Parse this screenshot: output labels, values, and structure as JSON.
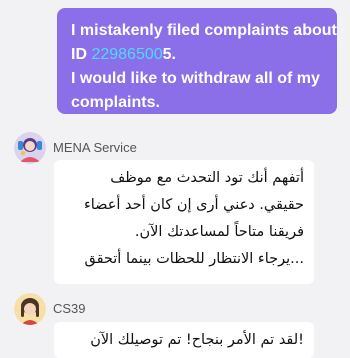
{
  "user_message": {
    "line1": "I mistakenly filed complaints about",
    "line2_prefix": "ID ",
    "ticket_id": "22986500",
    "line2_suffix": "5.",
    "line3": "I would like to withdraw all of my",
    "line4": "complaints."
  },
  "agent_message_1": {
    "sender": "MENA Service",
    "avatar_icon": "service-agent-avatar",
    "lines": [
      "أتفهم أنك تود التحدث مع موظف",
      "حقيقي. دعني أرى إن كان أحد أعضاء",
      "فريقنا متاحاً لمساعدتك الآن.",
      "...يرجاء الانتظار للحظات بينما أتحقق"
    ]
  },
  "agent_message_2": {
    "sender": "CS39",
    "avatar_icon": "agent-avatar",
    "lines": [
      "!لقد تم الأمر بنجاح! تم توصيلك الآن"
    ]
  },
  "colors": {
    "user_bubble": "#8a6fe8",
    "ticket_id": "#4dd9ff",
    "background": "#f2f2f5"
  }
}
